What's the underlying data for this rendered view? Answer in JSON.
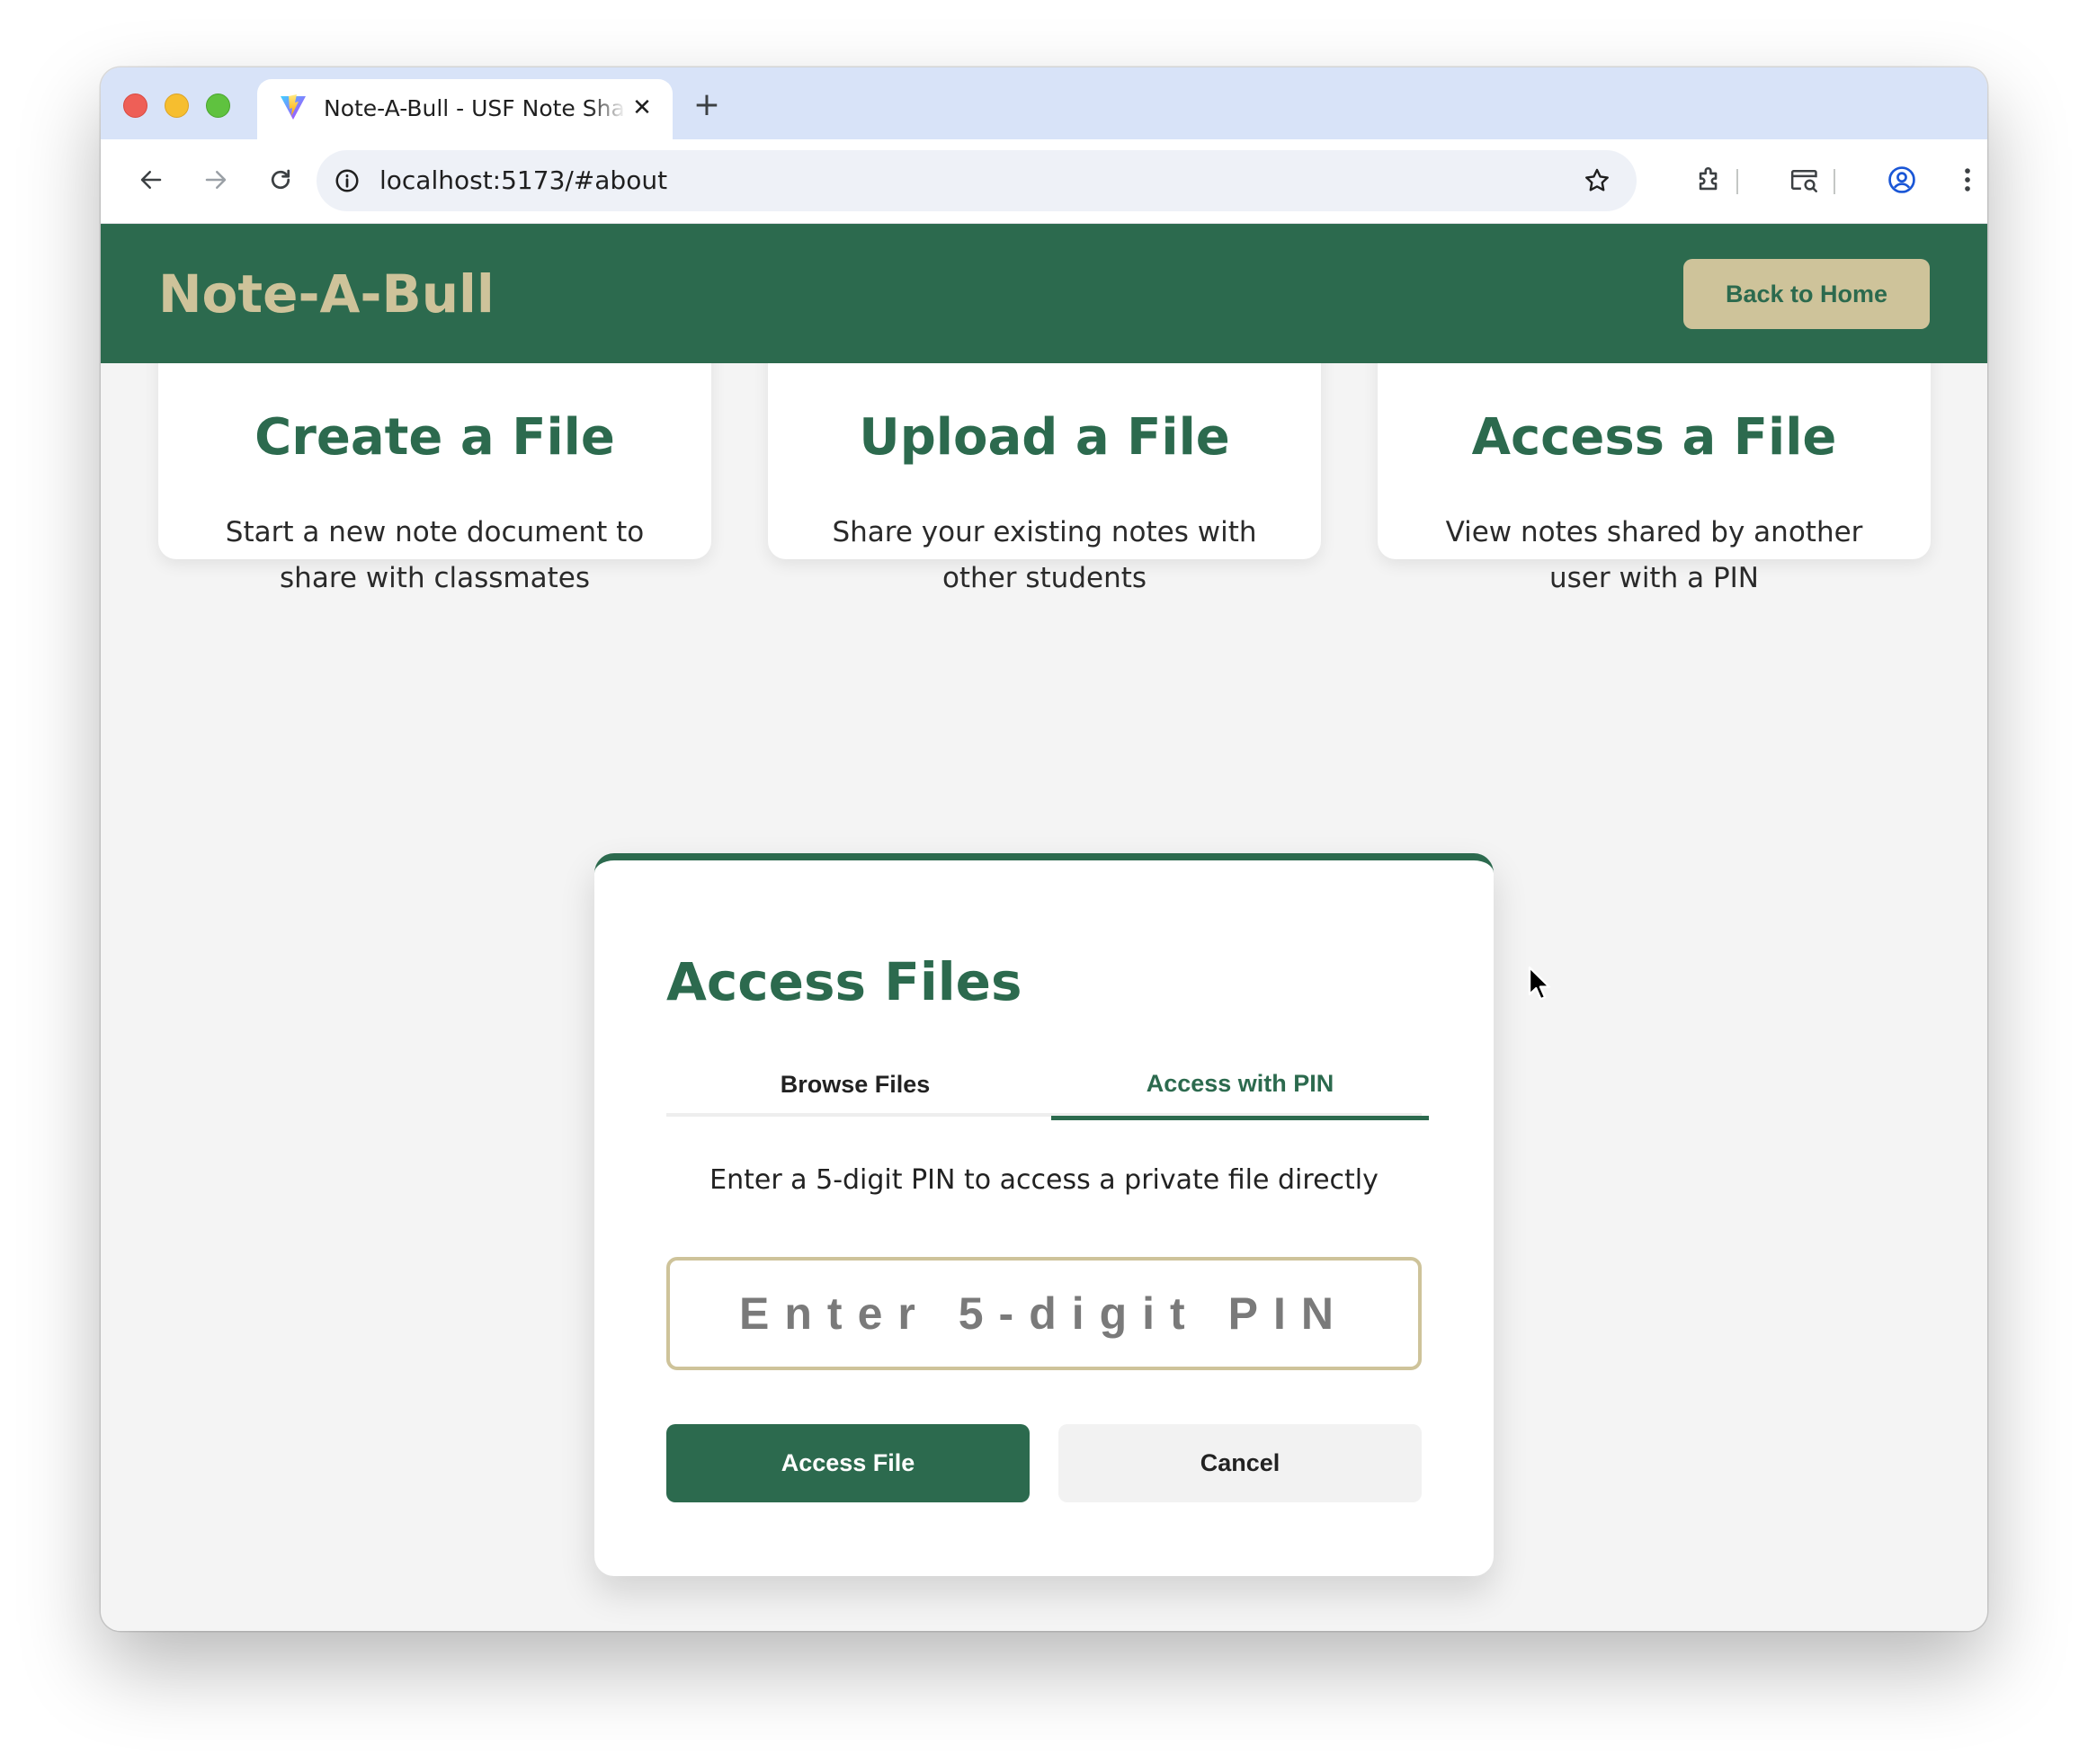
{
  "browser": {
    "tab_title": "Note-A-Bull - USF Note Sharing",
    "tab_close": "✕",
    "new_tab": "+",
    "url": "localhost:5173/#about"
  },
  "header": {
    "brand": "Note-A-Bull",
    "back_home_label": "Back to Home"
  },
  "cards": [
    {
      "title": "Create a File",
      "description": "Start a new note document to share with classmates"
    },
    {
      "title": "Upload a File",
      "description": "Share your existing notes with other students"
    },
    {
      "title": "Access a File",
      "description": "View notes shared by another user with a PIN"
    }
  ],
  "modal": {
    "title": "Access Files",
    "tabs": [
      {
        "label": "Browse Files",
        "active": false
      },
      {
        "label": "Access with PIN",
        "active": true
      }
    ],
    "pin_description": "Enter a 5-digit PIN to access a private file directly",
    "pin_input": {
      "placeholder": "Enter 5-digit PIN",
      "value": ""
    },
    "access_button": "Access File",
    "cancel_button": "Cancel"
  },
  "colors": {
    "brand_green": "#2c6a4e",
    "brand_gold": "#cec39a",
    "page_background": "#f4f4f4",
    "tab_strip": "#d8e3f8"
  },
  "icons": [
    "close-window-icon",
    "minimize-window-icon",
    "zoom-window-icon",
    "vite-favicon-icon",
    "back-arrow-icon",
    "forward-arrow-icon",
    "reload-icon",
    "site-info-icon",
    "bookmark-star-icon",
    "extensions-icon",
    "tab-search-icon",
    "profile-icon",
    "more-menu-icon",
    "mouse-cursor-icon"
  ]
}
